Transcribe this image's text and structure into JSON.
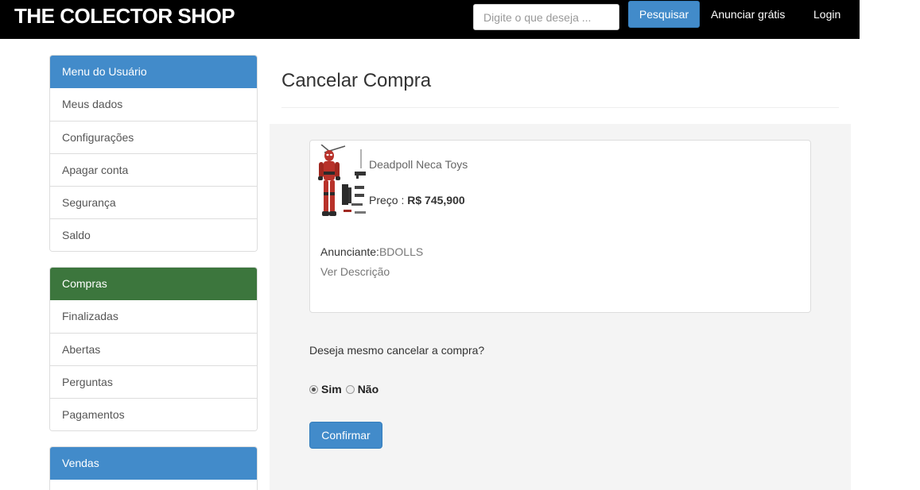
{
  "navbar": {
    "brand": "THE COLECTOR SHOP",
    "search_placeholder": "Digite o que deseja ...",
    "search_button": "Pesquisar",
    "links": [
      "Anunciar grátis",
      "Login"
    ]
  },
  "sidebar": {
    "user_menu": {
      "heading": "Menu do Usuário",
      "items": [
        "Meus dados",
        "Configurações",
        "Apagar conta",
        "Segurança",
        "Saldo"
      ]
    },
    "purchases": {
      "heading": "Compras",
      "items": [
        "Finalizadas",
        "Abertas",
        "Perguntas",
        "Pagamentos"
      ]
    },
    "sales": {
      "heading": "Vendas"
    }
  },
  "main": {
    "title": "Cancelar Compra",
    "product": {
      "name": "Deadpoll Neca Toys",
      "price_label": "Preço : ",
      "price_value": "R$ 745,900",
      "seller_label": "Anunciante:",
      "seller_name": "BDOLLS",
      "description_link": "Ver Descrição",
      "image_icon": "action-figure-image"
    },
    "question": "Deseja mesmo cancelar a compra?",
    "options": [
      {
        "label": "Sim",
        "checked": true
      },
      {
        "label": "Não",
        "checked": false
      }
    ],
    "confirm_button": "Confirmar"
  },
  "colors": {
    "navbar_bg": "#000000",
    "primary": "#428bca",
    "success_heading": "#3c763d",
    "content_bg": "#f4f4f4"
  }
}
